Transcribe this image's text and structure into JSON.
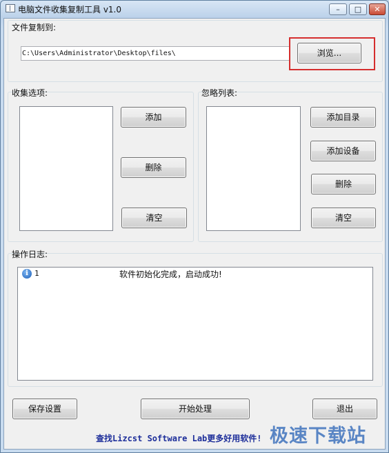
{
  "window": {
    "title": "电脑文件收集复制工具 v1.0",
    "minimize_glyph": "–",
    "maximize_glyph": "□",
    "close_glyph": "✕"
  },
  "destination": {
    "label": "文件复制到:",
    "path_value": "C:\\Users\\Administrator\\Desktop\\files\\",
    "browse_label": "浏览..."
  },
  "collect": {
    "label": "收集选项:",
    "add_label": "添加",
    "delete_label": "删除",
    "clear_label": "清空"
  },
  "ignore": {
    "label": "忽略列表:",
    "add_dir_label": "添加目录",
    "add_device_label": "添加设备",
    "delete_label": "删除",
    "clear_label": "清空"
  },
  "log": {
    "label": "操作日志:",
    "entries": [
      {
        "icon": "info-icon",
        "icon_glyph": "i",
        "index": "1",
        "message": "软件初始化完成，启动成功!"
      }
    ]
  },
  "actions": {
    "save_label": "保存设置",
    "start_label": "开始处理",
    "exit_label": "退出"
  },
  "footer": {
    "link_text": "查找Lizcst Software Lab更多好用软件!"
  },
  "watermark": {
    "text": "极速下载站"
  },
  "colors": {
    "highlight": "#d52d2d",
    "footer_link": "#1d2e9a",
    "watermark": "#3f73bd"
  }
}
